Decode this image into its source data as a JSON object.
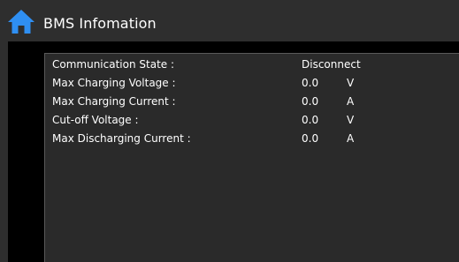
{
  "header": {
    "title": "BMS Infomation",
    "home_icon": "home-icon",
    "accent_color": "#2f8ff2"
  },
  "rows": [
    {
      "label": "Communication State :",
      "value": "Disconnect",
      "unit": ""
    },
    {
      "label": "Max Charging Voltage :",
      "value": "0.0",
      "unit": "V"
    },
    {
      "label": "Max Charging Current :",
      "value": "0.0",
      "unit": "A"
    },
    {
      "label": "Cut-off Voltage :",
      "value": "0.0",
      "unit": "V"
    },
    {
      "label": "Max Discharging Current :",
      "value": "0.0",
      "unit": "A"
    }
  ]
}
